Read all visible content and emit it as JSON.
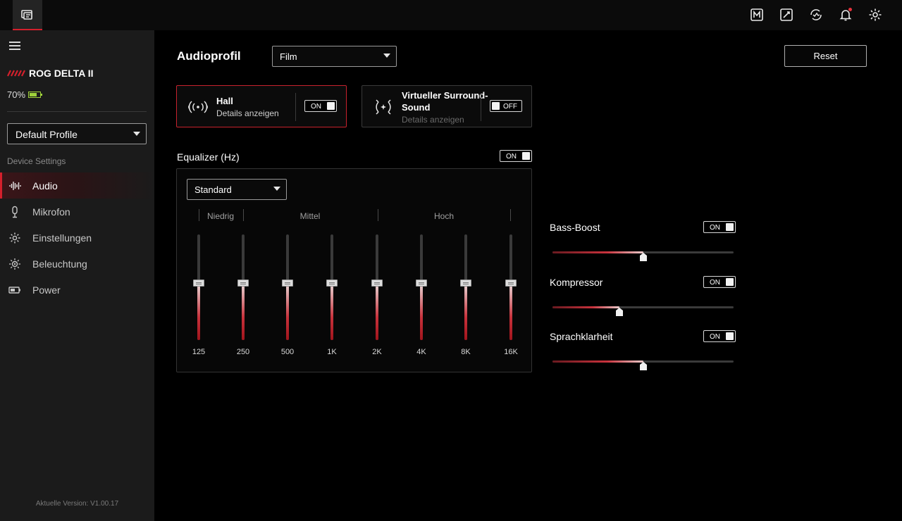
{
  "device": {
    "name": "ROG DELTA II",
    "battery": "70%",
    "battery_level": 0.7
  },
  "sidebar": {
    "profile": "Default Profile",
    "section_label": "Device Settings",
    "items": [
      {
        "label": "Audio",
        "icon": "waveform-icon",
        "active": true
      },
      {
        "label": "Mikrofon",
        "icon": "microphone-icon"
      },
      {
        "label": "Einstellungen",
        "icon": "gear-icon"
      },
      {
        "label": "Beleuchtung",
        "icon": "lighting-icon"
      },
      {
        "label": "Power",
        "icon": "battery-icon"
      }
    ],
    "version": "Aktuelle Version: V1.00.17"
  },
  "topbar": {
    "icons": [
      "macro-icon",
      "edit-icon",
      "sync-icon",
      "notification-bell-icon",
      "settings-gear-icon"
    ]
  },
  "main": {
    "title": "Audioprofil",
    "profile_value": "Film",
    "reset_label": "Reset",
    "hall": {
      "title": "Hall",
      "subtitle": "Details anzeigen",
      "toggle": "ON"
    },
    "surround": {
      "title": "Virtueller Surround-Sound",
      "subtitle": "Details anzeigen",
      "toggle": "OFF"
    },
    "equalizer": {
      "label": "Equalizer (Hz)",
      "toggle": "ON",
      "preset": "Standard",
      "bands": [
        "Niedrig",
        "Mittel",
        "Hoch"
      ],
      "frequencies": [
        "125",
        "250",
        "500",
        "1K",
        "2K",
        "4K",
        "8K",
        "16K"
      ],
      "levels": [
        0.54,
        0.54,
        0.54,
        0.54,
        0.54,
        0.54,
        0.54,
        0.54
      ]
    },
    "effects": [
      {
        "label": "Bass-Boost",
        "toggle": "ON",
        "value": 0.5
      },
      {
        "label": "Kompressor",
        "toggle": "ON",
        "value": 0.37
      },
      {
        "label": "Sprachklarheit",
        "toggle": "ON",
        "value": 0.5
      }
    ]
  },
  "colors": {
    "accent": "#d4202c",
    "battery": "#9fd23a"
  }
}
